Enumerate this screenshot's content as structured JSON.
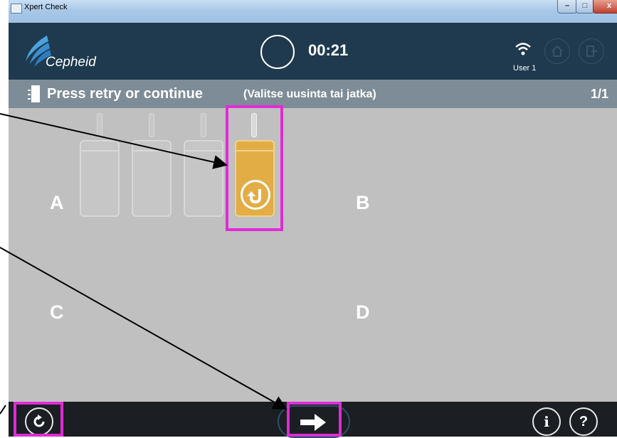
{
  "window": {
    "title": "Xpert Check",
    "minimize": "–",
    "maximize": "□",
    "close": "x"
  },
  "header": {
    "brand": "Cepheid",
    "timer": "00:21",
    "user": "User 1"
  },
  "instruction": {
    "text": "Press retry or continue",
    "translation": "(Valitse uusinta tai jatka)",
    "page": "1/1"
  },
  "quadrants": {
    "a": "A",
    "b": "B",
    "c": "C",
    "d": "D"
  },
  "slots": [
    {
      "state": "empty"
    },
    {
      "state": "empty"
    },
    {
      "state": "empty"
    },
    {
      "state": "retry",
      "color": "#e3ad45"
    }
  ],
  "bottom": {
    "info": "i",
    "help": "?"
  },
  "colors": {
    "highlight": "#e02bd6",
    "header_bg": "#1f3a4e",
    "instruction_bg": "#7d8c96",
    "main_bg": "#c0c0c0"
  }
}
